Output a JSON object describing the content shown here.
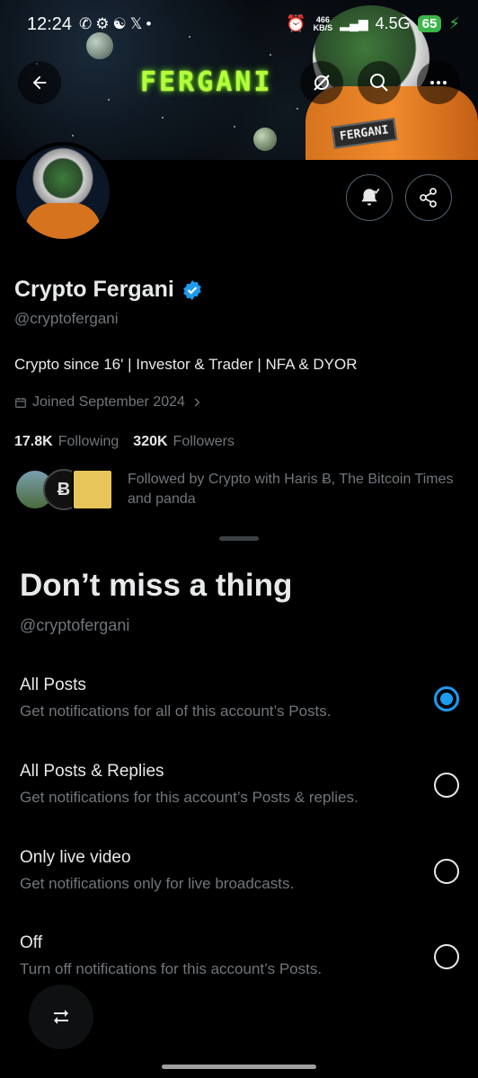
{
  "status_bar": {
    "time": "12:24",
    "net_speed_value": "466",
    "net_speed_unit": "KB/S",
    "network": "4.5G",
    "battery": "65"
  },
  "header": {
    "banner_text": "FERGANI",
    "suit_label": "FERGANI"
  },
  "profile": {
    "name": "Crypto Fergani",
    "handle": "@cryptofergani",
    "bio": "Crypto since 16' | Investor & Trader | NFA & DYOR",
    "joined": "Joined September 2024",
    "following_count": "17.8K",
    "following_label": "Following",
    "followers_count": "320K",
    "followers_label": "Followers",
    "followed_by": "Followed by Crypto with Haris Ƀ, The Bitcoin Times and panda"
  },
  "sheet": {
    "title": "Don’t miss a thing",
    "handle": "@cryptofergani",
    "options": [
      {
        "title": "All Posts",
        "desc": "Get notifications for all of this account’s Posts.",
        "selected": true
      },
      {
        "title": "All Posts & Replies",
        "desc": "Get notifications for this account’s Posts & replies.",
        "selected": false
      },
      {
        "title": "Only live video",
        "desc": "Get notifications only for live broadcasts.",
        "selected": false
      },
      {
        "title": "Off",
        "desc": "Turn off notifications for this account’s Posts.",
        "selected": false
      }
    ]
  },
  "colors": {
    "accent": "#1d9bf0",
    "background": "#000000",
    "text_primary": "#e7e9ea",
    "text_secondary": "#71767b",
    "battery": "#3bb54a"
  },
  "icons": [
    "back-arrow-icon",
    "grok-icon",
    "search-icon",
    "more-icon",
    "bell-check-icon",
    "share-icon",
    "verified-badge-icon",
    "calendar-icon",
    "chevron-right-icon",
    "repost-icon"
  ]
}
